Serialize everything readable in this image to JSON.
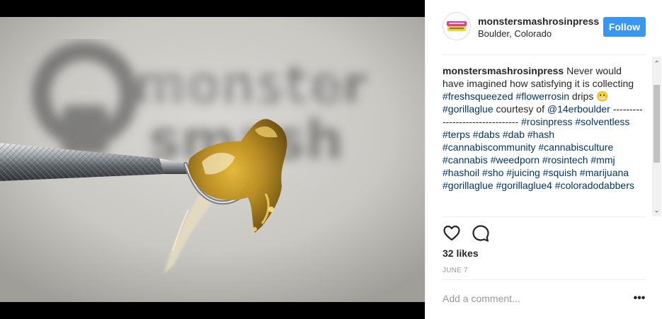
{
  "post": {
    "username": "monstersmashrosinpress",
    "location": "Boulder, Colorado",
    "follow_label": "Follow",
    "caption": {
      "username": "monstersmashrosinpress",
      "text1": "Never would have imagined how satisfying it is collecting",
      "tag_freshsqueezed": "#freshsqueezed",
      "tag_flowerrosin": "#flowerrosin",
      "text2": "drips",
      "emoji": "😬",
      "tag_gorillaglue_1": "#gorillaglue",
      "text3": "courtesy of",
      "mention": "@14erboulder",
      "dashes": "--------------------------------",
      "hashtag_block": "#rosinpress #solventless #terps #dabs #dab #hash #cannabiscommunity #cannabisculture #cannabis #weedporn #rosintech #mmj #hashoil #sho #juicing #squish #marijuana #gorillaglue #gorillaglue4 #coloradodabbers"
    },
    "likes": "32 likes",
    "date": "JUNE 7",
    "comment_placeholder": "Add a comment...",
    "more_label": "•••"
  },
  "icons": {
    "heart": "heart-icon",
    "comment": "comment-icon",
    "avatar": "brand-logo"
  },
  "colors": {
    "follow_button": "#3897f0",
    "hashtag": "#003569",
    "text": "#262626",
    "muted": "#999999"
  }
}
